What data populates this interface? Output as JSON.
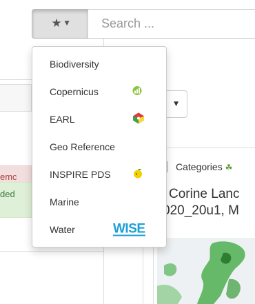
{
  "search": {
    "favourites_icon": "star-icon",
    "caret_icon": "caret-down-icon",
    "placeholder": "Search ..."
  },
  "menu": {
    "items": [
      {
        "label": "Biodiversity",
        "logo": null
      },
      {
        "label": "Copernicus",
        "logo": "copernicus-logo"
      },
      {
        "label": "EARL",
        "logo": "earl-logo"
      },
      {
        "label": "Geo Reference",
        "logo": null
      },
      {
        "label": "INSPIRE PDS",
        "logo": "inspire-pds-logo"
      },
      {
        "label": "Marine",
        "logo": null
      },
      {
        "label": "Water",
        "logo": "wise-logo",
        "logo_text": "WISE"
      }
    ]
  },
  "background": {
    "status_red_text": "emc",
    "status_green_text": "ded",
    "tabs": {
      "categories_label": "Categories"
    },
    "record_title_line1": "Corine Lanc",
    "record_title_line2": "020_20u1, M"
  },
  "colors": {
    "accent_blue": "#1a9fd6",
    "copernicus_green": "#8cc63f",
    "inspire_yellow": "#f5d000",
    "map_green": "#4caf50"
  }
}
